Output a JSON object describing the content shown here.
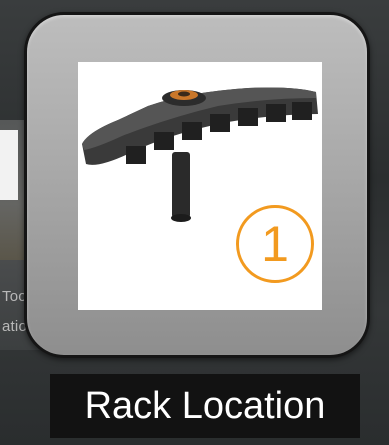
{
  "background_items": {
    "partial_label_line1": "Tool",
    "partial_label_line2": "ation"
  },
  "card": {
    "icon": "rack-fixture-image",
    "badge_number": "1",
    "caption": "Rack Location"
  },
  "colors": {
    "badge": "#f29a1f",
    "caption_bg": "#121212",
    "caption_text": "#ffffff",
    "card_bg": "#a9a9a9"
  }
}
